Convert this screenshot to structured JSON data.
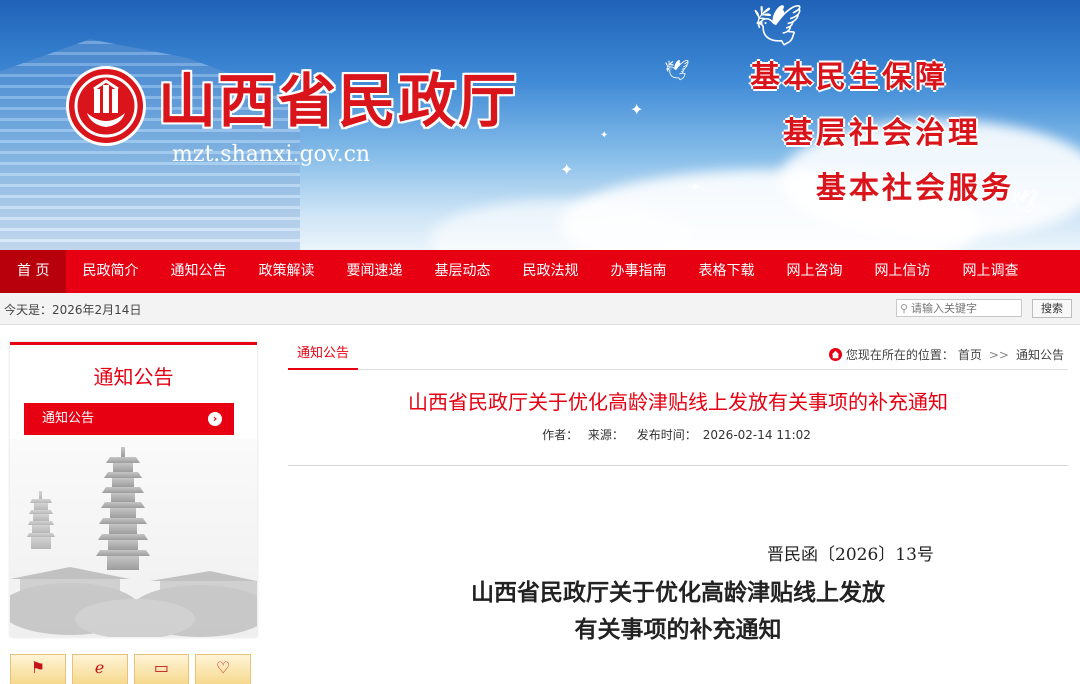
{
  "banner": {
    "site_title": "山西省民政厅",
    "domain": "mzt.shanxi.gov.cn",
    "slogans": [
      "基本民生保障",
      "基层社会治理",
      "基本社会服务"
    ]
  },
  "nav": {
    "items": [
      "首 页",
      "民政简介",
      "通知公告",
      "政策解读",
      "要闻速递",
      "基层动态",
      "民政法规",
      "办事指南",
      "表格下载",
      "网上咨询",
      "网上信访",
      "网上调查"
    ],
    "active_index": 0
  },
  "infobar": {
    "date_text": "今天是：2026年2月14日",
    "search_placeholder": "请输入关键字",
    "search_button": "搜索"
  },
  "sidebar": {
    "title": "通知公告",
    "items": [
      {
        "label": "通知公告",
        "icon": "chevron-right-icon"
      }
    ],
    "quick_link_icons": [
      "signpost-icon",
      "info-icon",
      "monitor-icon",
      "heart-icon"
    ]
  },
  "content": {
    "tab": "通知公告",
    "location_label": "您现在所在的位置：",
    "breadcrumb": [
      "首页",
      "通知公告"
    ],
    "breadcrumb_separator": ">>",
    "article_title": "山西省民政厅关于优化高龄津贴线上发放有关事项的补充通知",
    "meta": {
      "author_label": "作者：",
      "source_label": "来源：",
      "published_label": "发布时间：",
      "published": "2026-02-14 11:02"
    },
    "doc_number": "晋民函〔2026〕13号",
    "doc_title_lines": [
      "山西省民政厅关于优化高龄津贴线上发放",
      "有关事项的补充通知"
    ]
  },
  "colors": {
    "brand_red": "#e60012",
    "nav_active": "#b7000c",
    "sky_top": "#1f62b8"
  }
}
